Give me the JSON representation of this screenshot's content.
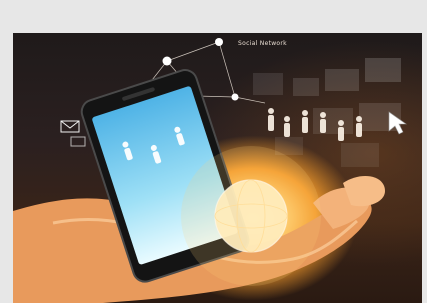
{
  "image": {
    "label_text": "Social Network",
    "colors": {
      "frame": "#e7e7e7",
      "glow": "#ffcf72",
      "screen_top": "#4fb3e6",
      "screen_bottom": "#c7f0ff",
      "hand": "#f2a56a"
    },
    "icons": [
      "phone-icon",
      "globe-icon",
      "envelope-icon",
      "cursor-icon",
      "person-icon"
    ]
  }
}
